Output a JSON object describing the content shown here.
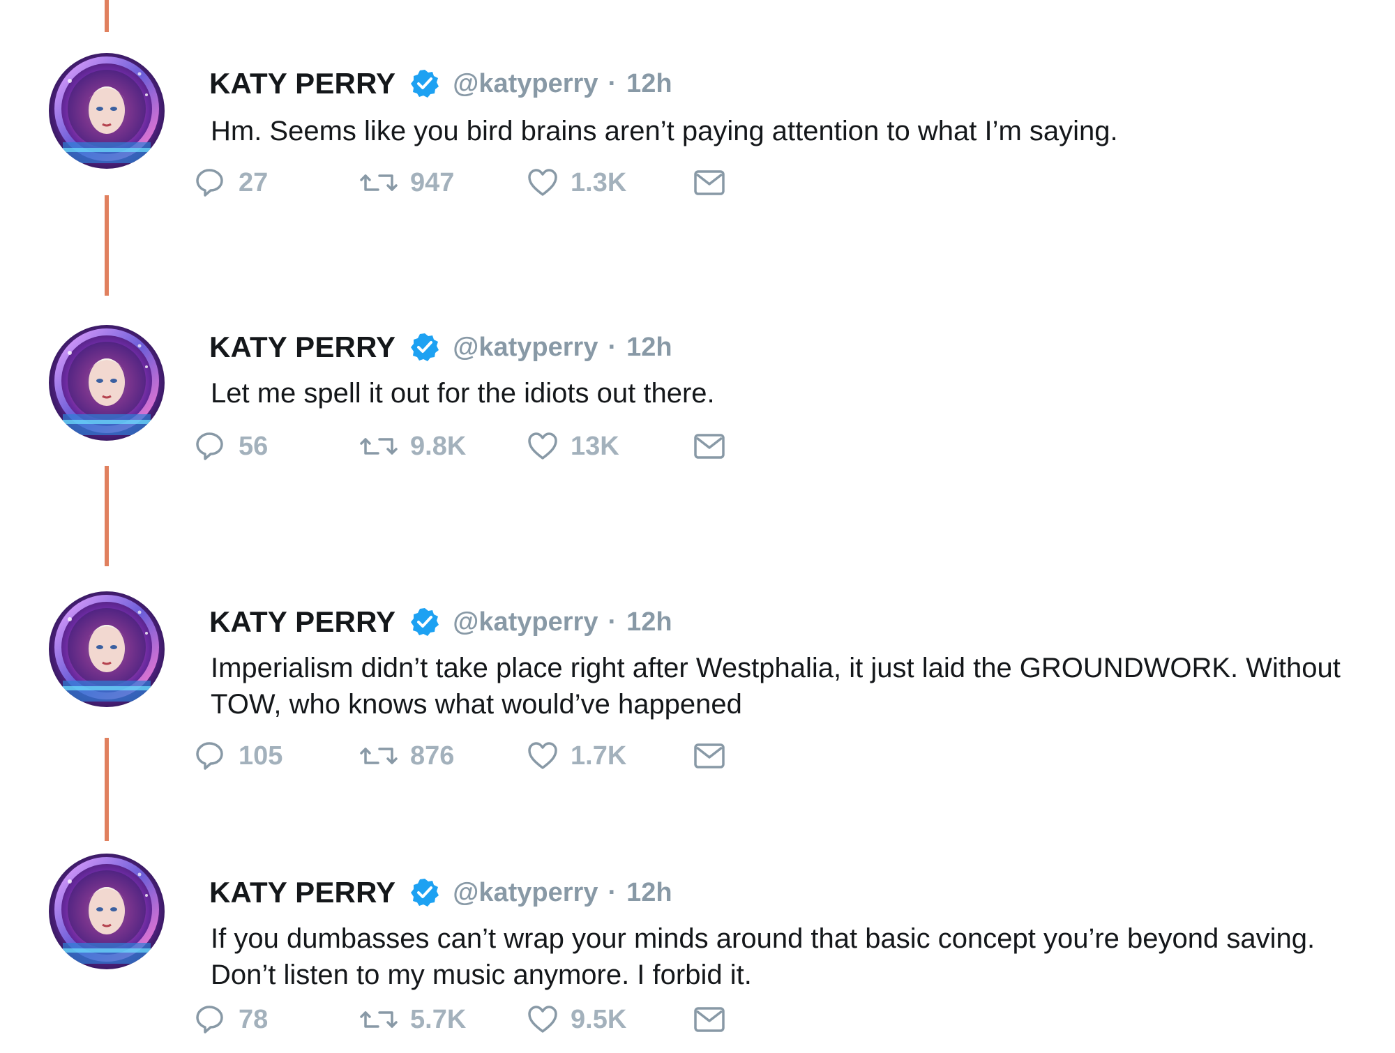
{
  "tweets": [
    {
      "name": "KATY PERRY",
      "handle": "@katyperry",
      "separator": "·",
      "time": "12h",
      "text": "Hm. Seems like you bird brains aren’t paying attention to what I’m saying.",
      "replies": "27",
      "retweets": "947",
      "likes": "1.3K"
    },
    {
      "name": "KATY PERRY",
      "handle": "@katyperry",
      "separator": "·",
      "time": "12h",
      "text": "Let me spell it out for the idiots out there.",
      "replies": "56",
      "retweets": "9.8K",
      "likes": "13K"
    },
    {
      "name": "KATY PERRY",
      "handle": "@katyperry",
      "separator": "·",
      "time": "12h",
      "text": "Imperialism didn’t take place right after Westphalia, it just laid the GROUNDWORK. Without TOW, who knows what would’ve happened",
      "replies": "105",
      "retweets": "876",
      "likes": "1.7K"
    },
    {
      "name": "KATY PERRY",
      "handle": "@katyperry",
      "separator": "·",
      "time": "12h",
      "text": "If you dumbasses can’t wrap your minds around that basic concept you’re beyond saving. Don’t listen to my music anymore. I forbid it.",
      "replies": "78",
      "retweets": "5.7K",
      "likes": "9.5K"
    }
  ],
  "colors": {
    "thread_line": "#e0805e",
    "verified": "#1da1f2",
    "handle": "#8899a6",
    "action": "#a3b1bc",
    "text": "#14171a"
  },
  "icons": {
    "reply": "reply-icon",
    "retweet": "retweet-icon",
    "like": "heart-icon",
    "dm": "envelope-icon",
    "verified": "verified-badge-icon"
  }
}
